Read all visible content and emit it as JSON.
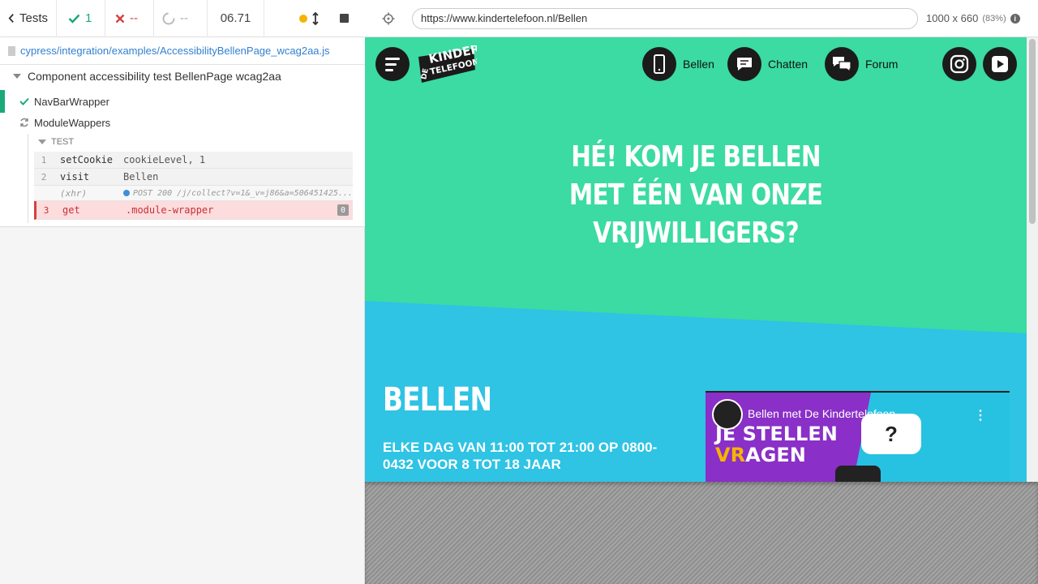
{
  "reporter": {
    "tests_label": "Tests",
    "passed": "1",
    "failed": "--",
    "pending": "--",
    "duration": "06.71",
    "spec_path": "cypress/integration/examples/AccessibilityBellenPage_wcag2aa.js",
    "suite_title": "Component accessibility test BellenPage wcag2aa",
    "tests": [
      {
        "title": "NavBarWrapper",
        "state": "passed"
      },
      {
        "title": "ModuleWappers",
        "state": "running"
      }
    ],
    "section_label": "TEST",
    "commands": [
      {
        "num": "1",
        "name": "setCookie",
        "message": "cookieLevel, 1"
      },
      {
        "num": "2",
        "name": "visit",
        "message": "Bellen"
      },
      {
        "num": "",
        "name": "(xhr)",
        "message": "POST 200 /j/collect?v=1&_v=j86&a=506451425..."
      },
      {
        "num": "3",
        "name": "get",
        "message": ".module-wrapper",
        "count": "0"
      }
    ],
    "colors": {
      "passed": "#1aa97a",
      "failed": "#d3413f",
      "link": "#3380d0"
    }
  },
  "aut": {
    "url": "https://www.kindertelefoon.nl/Bellen",
    "viewport": "1000 x 660",
    "zoom": "(83%)",
    "nav": {
      "logo_line1": "DE",
      "logo_line2": "KINDER",
      "logo_line3": "TELEFOON.NL",
      "links": [
        "Bellen",
        "Chatten",
        "Forum"
      ]
    },
    "hero_title": "HÉ! KOM JE BELLEN MET ÉÉN VAN ONZE VRIJWILLIGERS?",
    "section_heading": "BELLEN",
    "section_sub": "ELKE DAG VAN 11:00 TOT 21:00 OP 0800-0432 VOOR 8 TOT 18 JAAR",
    "video": {
      "title": "Bellen met De Kindertelefoon",
      "line1": "JE STELLEN",
      "line2a": "VR",
      "line2b": "AGEN",
      "bubble": "?"
    },
    "colors": {
      "green": "#3bdba3",
      "blue": "#2fc3e4",
      "purple": "#8a2fc7"
    }
  }
}
